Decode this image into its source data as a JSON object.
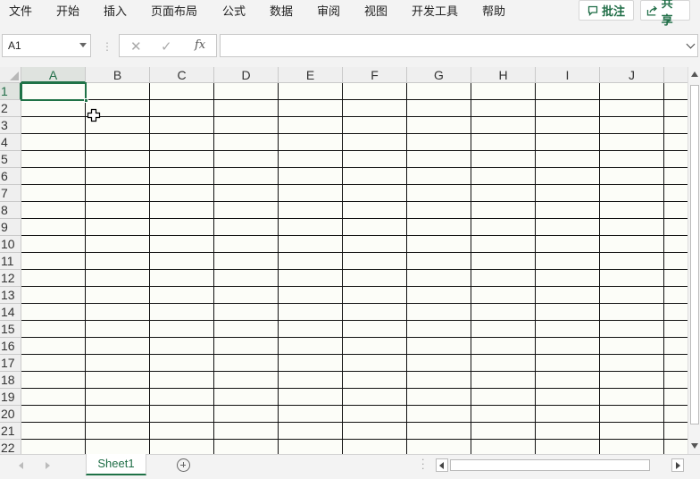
{
  "menu": {
    "items": [
      "文件",
      "开始",
      "插入",
      "页面布局",
      "公式",
      "数据",
      "审阅",
      "视图",
      "开发工具",
      "帮助"
    ],
    "comment_button": "批注",
    "share_button": "共享"
  },
  "formula_bar": {
    "name_box": "A1",
    "cancel_icon": "✕",
    "enter_icon": "✓",
    "fx_label": "fx",
    "content": ""
  },
  "sheet": {
    "columns": [
      "A",
      "B",
      "C",
      "D",
      "E",
      "F",
      "G",
      "H",
      "I",
      "J"
    ],
    "rows": [
      "1",
      "2",
      "3",
      "4",
      "5",
      "6",
      "7",
      "8",
      "9",
      "10",
      "11",
      "12",
      "13",
      "14",
      "15",
      "16",
      "17",
      "18",
      "19",
      "20",
      "21",
      "22"
    ],
    "active_cell": "A1"
  },
  "tabs": {
    "sheets": [
      "Sheet1"
    ],
    "active": "Sheet1"
  },
  "colors": {
    "accent": "#1f7247",
    "grid_line": "#111111",
    "header_bg": "#efefef"
  }
}
